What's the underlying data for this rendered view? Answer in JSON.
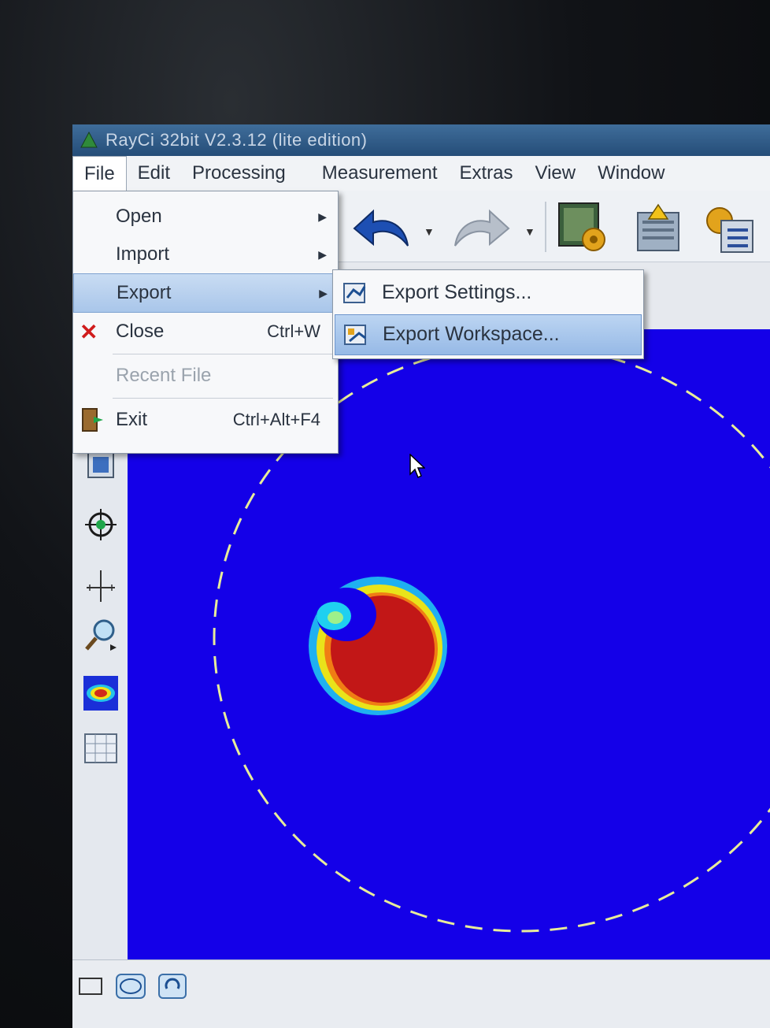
{
  "window": {
    "title": "RayCi 32bit V2.3.12 (lite edition)"
  },
  "menubar": {
    "items": [
      "File",
      "Edit",
      "Processing",
      "Measurement",
      "Extras",
      "View",
      "Window"
    ]
  },
  "file_menu": {
    "open": "Open",
    "import": "Import",
    "export": "Export",
    "close": "Close",
    "close_shortcut": "Ctrl+W",
    "recent": "Recent File",
    "exit": "Exit",
    "exit_shortcut": "Ctrl+Alt+F4"
  },
  "export_submenu": {
    "settings": "Export Settings...",
    "workspace": "Export Workspace..."
  },
  "colors": {
    "canvas_background": "#1400e8",
    "beam_core": "#c21717",
    "menu_highlight": "#a9c6ea"
  },
  "icons": [
    "app-icon",
    "undo-icon",
    "redo-icon",
    "settings-icon",
    "warning-document-icon",
    "checklist-icon",
    "close-x-icon",
    "exit-door-icon",
    "export-settings-icon",
    "export-workspace-icon",
    "crosshair-icon",
    "zoom-icon",
    "beam-profile-icon",
    "grid-icon"
  ]
}
